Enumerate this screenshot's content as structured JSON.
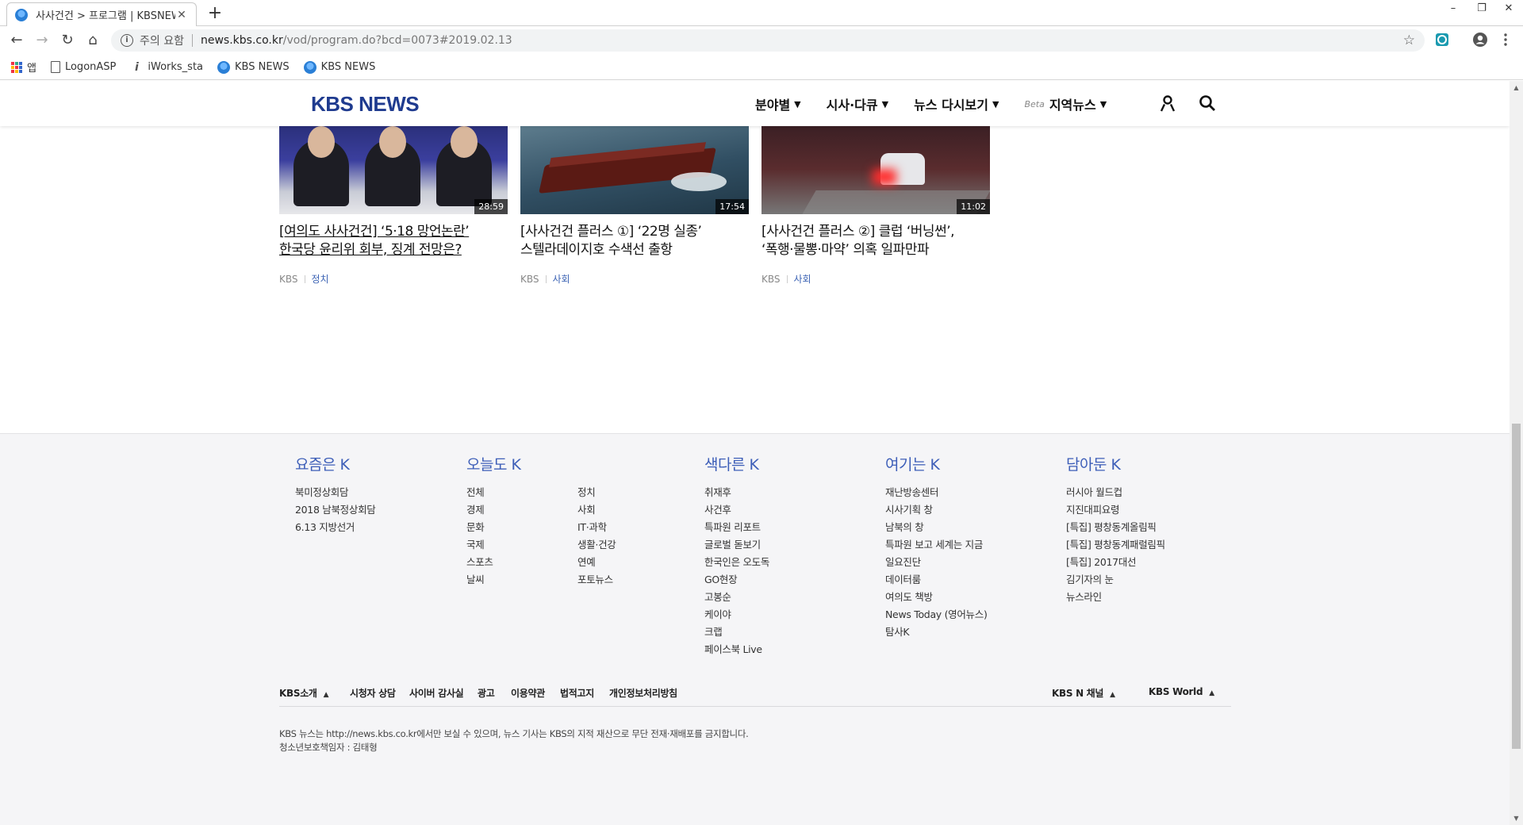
{
  "browser": {
    "tab_title": "사사건건 > 프로그램 | KBSNEWS",
    "tab_close": "✕",
    "new_tab": "+",
    "window_controls": {
      "minimize": "–",
      "restore": "❐",
      "close": "✕"
    },
    "nav": {
      "back": "←",
      "forward": "→",
      "reload": "↻",
      "home": "⌂"
    },
    "security_text": "주의 요함",
    "url_host": "news.kbs.co.kr",
    "url_path": "/vod/program.do?bcd=0073#2019.02.13",
    "bookmarks": [
      {
        "label": "앱",
        "icon": "apps-icon"
      },
      {
        "label": "LogonASP",
        "icon": "doc-icon"
      },
      {
        "label": "iWorks_sta",
        "icon": "iworks-icon"
      },
      {
        "label": "KBS NEWS",
        "icon": "kbs-favicon"
      },
      {
        "label": "KBS NEWS",
        "icon": "kbs-favicon"
      }
    ]
  },
  "header": {
    "logo": "KBS NEWS",
    "nav": [
      {
        "label": "분야별",
        "caret": "▼"
      },
      {
        "label": "시사·다큐",
        "caret": "▼"
      },
      {
        "label": "뉴스 다시보기",
        "caret": "▼"
      },
      {
        "label": "지역뉴스",
        "caret": "▼",
        "badge": "Beta"
      }
    ]
  },
  "cards": [
    {
      "title_line1": "[여의도 사사건건] ‘5·18 망언논란’",
      "title_line2": "한국당 윤리위 회부, 징계 전망은?",
      "duration": "28:59",
      "source": "KBS",
      "category": "정치"
    },
    {
      "title_line1": "[사사건건 플러스 ①] ‘22명 실종’",
      "title_line2": "스텔라데이지호 수색선 출항",
      "duration": "17:54",
      "source": "KBS",
      "category": "사회"
    },
    {
      "title_line1": "[사사건건 플러스 ②] 클럽 ‘버닝썬’,",
      "title_line2": "‘폭행·물뽕·마약’ 의혹 일파만파",
      "duration": "11:02",
      "source": "KBS",
      "category": "사회"
    }
  ],
  "footer": {
    "columns": [
      {
        "title": "요즘은 K",
        "items": [
          "북미정상회담",
          "2018 남북정상회담",
          "6.13 지방선거"
        ]
      },
      {
        "title": "오늘도 K",
        "items": [
          "전체",
          "정치",
          "경제",
          "사회",
          "문화",
          "IT·과학",
          "국제",
          "생활·건강",
          "스포츠",
          "연예",
          "날씨",
          "포토뉴스"
        ]
      },
      {
        "title": "색다른 K",
        "items": [
          "취재후",
          "사건후",
          "특파원 리포트",
          "글로벌 돋보기",
          "한국인은 오도독",
          "GO현장",
          "고봉순",
          "케이야",
          "크랩",
          "페이스북 Live"
        ]
      },
      {
        "title": "여기는 K",
        "items": [
          "재난방송센터",
          "시사기획 창",
          "남북의 창",
          "특파원 보고 세계는 지금",
          "일요진단",
          "데이터룸",
          "여의도 책방",
          "News Today (영어뉴스)",
          "탐사K"
        ]
      },
      {
        "title": "담아둔 K",
        "items": [
          "러시아 월드컵",
          "지진대피요령",
          "[특집] 평창동계올림픽",
          "[특집] 평창동계패럴림픽",
          "[특집] 2017대선",
          "김기자의 눈",
          "뉴스라인"
        ]
      }
    ],
    "bar": {
      "about": "KBS소개",
      "links": [
        "시청자 상담",
        "사이버 감사실",
        "광고",
        "이용약관",
        "법적고지",
        "개인정보처리방침"
      ],
      "channel": "KBS N 채널",
      "world": "KBS World",
      "up": "▲"
    },
    "copyright": "KBS 뉴스는 http://news.kbs.co.kr에서만 보실 수 있으며, 뉴스 기사는 KBS의 지적 재산으로 무단 전재·재배포를 금지합니다.",
    "youth_officer": "청소년보호책임자 : 김태형"
  }
}
